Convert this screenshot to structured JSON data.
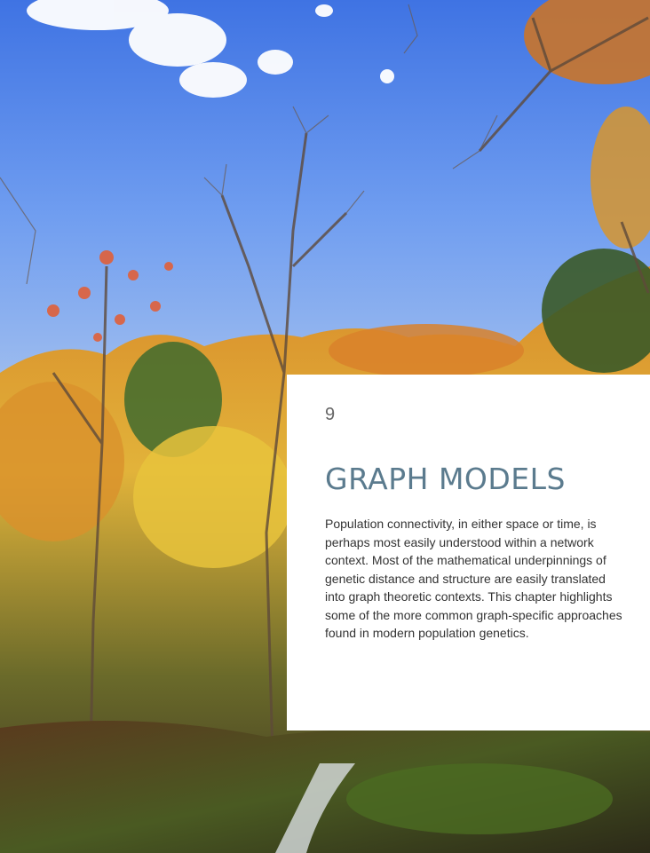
{
  "chapter": {
    "number": "9",
    "title": "GRAPH MODELS",
    "abstract": "Population connectivity, in either space or time, is perhaps most easily understood within a network context.  Most of the mathematical underpinnings of genetic distance and structure are easily translated into graph theoretic contexts.  This chapter highlights some of the more common graph-specific approaches found in modern population genetics."
  },
  "colors": {
    "title": "#5b7b8e",
    "sky": "#4a7fe6",
    "card": "#ffffff"
  },
  "icons": {
    "background": "autumn-forest-photo"
  }
}
